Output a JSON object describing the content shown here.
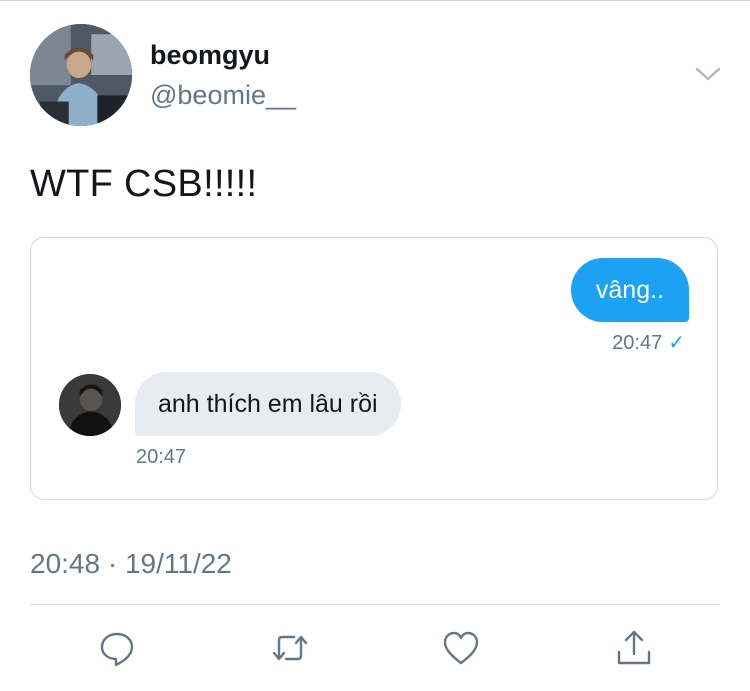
{
  "tweet": {
    "author": {
      "display_name": "beomgyu",
      "handle": "@beomie__",
      "avatar_icon": "profile-photo"
    },
    "text": "WTF CSB!!!!!",
    "embedded_chat": {
      "messages": [
        {
          "direction": "outgoing",
          "text": "vâng..",
          "time": "20:47",
          "status": "✓"
        },
        {
          "direction": "incoming",
          "text": "anh thích em lâu rồi",
          "time": "20:47",
          "avatar_icon": "contact-photo"
        }
      ]
    },
    "timestamp": "20:48 · 19/11/22",
    "actions": [
      {
        "name": "reply",
        "icon": "reply-icon"
      },
      {
        "name": "retweet",
        "icon": "retweet-icon"
      },
      {
        "name": "like",
        "icon": "heart-icon"
      },
      {
        "name": "share",
        "icon": "share-icon"
      }
    ],
    "colors": {
      "accent": "#1da1f2",
      "text": "#14171a",
      "secondary_text": "#657786",
      "incoming_bubble": "#e6ecf0",
      "border": "#d6d9dc"
    }
  }
}
